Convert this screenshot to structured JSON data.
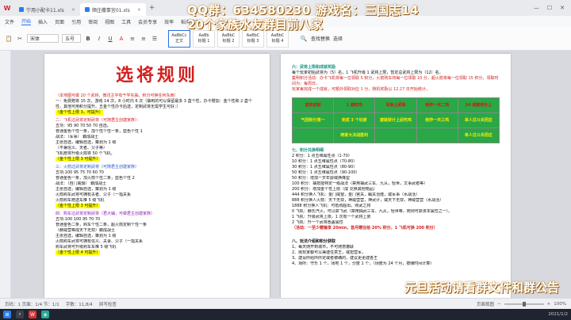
{
  "titlebar": {
    "logo": "W",
    "tabs": [
      {
        "label": "宁用小配卡11.xls",
        "active": false
      },
      {
        "label": "顺庄撒事宜01.xls",
        "active": true
      }
    ]
  },
  "overlay": {
    "line1": "QQ群：634580230 游戏名：三国志14",
    "line2": "20个家族水友群目前八家",
    "line3": "元旦活动请看群文件和群公告"
  },
  "menu": [
    "文件",
    "开始",
    "插入",
    "页面",
    "引用",
    "审阅",
    "视图",
    "工具",
    "会员专享",
    "效率",
    "稻壳资源"
  ],
  "menu_active": "开始",
  "ribbon": {
    "font": "宋体",
    "size": "五号",
    "styles": [
      {
        "label": "正文",
        "sub": "AaBbCc"
      },
      {
        "label": "标题 1",
        "sub": "AaBb"
      },
      {
        "label": "标题 2",
        "sub": "AaBbC"
      },
      {
        "label": "标题 3",
        "sub": "AaBbC"
      },
      {
        "label": "标题 4",
        "sub": "AaBbC"
      }
    ],
    "find": "查找替换",
    "select": "选择"
  },
  "page1": {
    "title": "选将规则",
    "intro": "（本地图可做 20 个武将，微讯主宇有干学先抽，积分可换任何东西）",
    "l1": "一：免费赠将 15 次，游戏 14 次，8 小时内 6 次（抽到的可以保留最多 3 盏个性，办卡赠加：金个性和 2 盏个性，其他可用积分提升。五金个性办卡后送，定制武将无需学生可好：）",
    "hl1": "（金个性上限 3，可提升）",
    "s2": "二：飞机过武将定制武将（可随君主创建家族）：",
    "s2_items": [
      "五项：95 90 70 50 70 自选。",
      "普通金色个性一条，加个性个性一条，蓝色个性 1",
      "战法：（军事）  霸成战士",
      "主张自选，编辑自选，策划为 1 级",
      "（不兼信义、天者、父子等）",
      "飞机赠将升级火箭将 50 个飞机。"
    ],
    "hl2": "（金个性上限 3 可提升）",
    "s3": "三：火箭过武将定制武将（可随君主创建家族）",
    "s3_items": [
      "五项:100 95 75 70 60 70",
      "普通金色一条，加火箭个性二条，蓝色个性 2",
      "战法：（自门威慑）  霸成战士",
      "主张自选，编辑自选，策划为 1 级",
      "火箭购车武将可拥有夫者、父子（一指关系",
      "火箭购车赠送车推 5 级飞机"
    ],
    "hl3": "（金个性上限 3 可提升）",
    "s4": "四：购车过武将定制武将（君大辅，可做君主创建家族）",
    "s4_items": [
      "五项:100 100 95 70 70",
      "普通金色二条，购车个性二条，超火箭定制个性一条",
      "（赫威营等成天下无双）霸成战士",
      "主张自选，编辑自选，策划为 1 级",
      "火箭购车武将可拥有信义、夫妻、父子（一指关系",
      "购车武将可升级购车车推 5 级飞机"
    ],
    "hl4": "（金个性上限 4 可提升）"
  },
  "page2": {
    "s6": "六：武将上限和成就奖励",
    "s6_l1": "每个玩家初始武将为（5）名，1 飞机升级 1 武将上限，暂定总武将上限为（12）名。",
    "s6_red": [
      "集明积分活动：办卡飞机将每一位领取 5 积分，火箭购车将每一位领取 10 分，超火箭将每一位领取 15 积分，领取时间为：每周日。",
      "玩家每完成一个成就，可额外领取对应 1 分，随机奖励以 12.27 日开始统计。"
    ],
    "table": [
      [
        "首府成就",
        "1 城吃鸡",
        "军亲上武将",
        "抢炸一天二鸡",
        "24 城被收计上"
      ],
      [
        "气回积分第一",
        "完成 3 个玩家",
        "被破获计上后吃鸡",
        "抢炸一天三鸡",
        "单人过斗关而庄"
      ],
      [
        "",
        "两家大决战胜利",
        "",
        "",
        "单人过斗关而庄"
      ]
    ],
    "s7": "七、积分兑换明细",
    "s7_items": [
      "2 积分：1 点五维属性点（1-70）",
      "10 积分：1 点五维属性点（70-80）",
      "30 积分：1 点五维属性点（80-90）",
      "50 积分：1 点五维属性点（90-100）",
      "50 积分：增加一岁年龄或换降型",
      "100 积分：抽技能特定一级战法（禁用抽武三车、九从，轻世，文事武者等）",
      "200 积分：增加金个性上限（成 兑换其他物品）",
      "444 积分换人飞机：金门威望，金门宫关，瞩关治隆，或军事（水战活）",
      "888 积分换人火箭：天下无双，神威营营，神武计，或天下无双，神威营营（水战活）",
      "1888 积分换人飞机：可抵购超出，购武之将",
      "0 飞机：赫氏汽火，可以获飞武（禁用抽武三车、九从，轻世等，随则可获该本属性之一）。",
      "1 飞机：升级武将上限，1 次有一个武将上限",
      "2 飞机：升一个武将悉盖属性"
    ],
    "s7_red": "（活动：一至少赠输享 20min，首月赠在给 20% 积分，1 飞机可换 200 积分）",
    "s8": "八、玩法介绍和积分获取",
    "s8_items": [
      "1、每天随开到城市，不可随意撤联",
      "2、抛玩家都可以兼建任意王，或担营军，",
      "3、建设所给所所定或者被确的，建议更更建各王",
      "4、场所：守乐 1 个，场地 1 个，分度 1 个，（场度为 24 个月，按赚时间计算）"
    ]
  },
  "status": {
    "page": "页码：1  页面：1/4  节：1/1",
    "words": "字数：11,8/4",
    "spell": "拼写检查",
    "layout": "页面视图",
    "zoom": "100%"
  },
  "taskbar": {
    "clock": "2021/1/2"
  }
}
